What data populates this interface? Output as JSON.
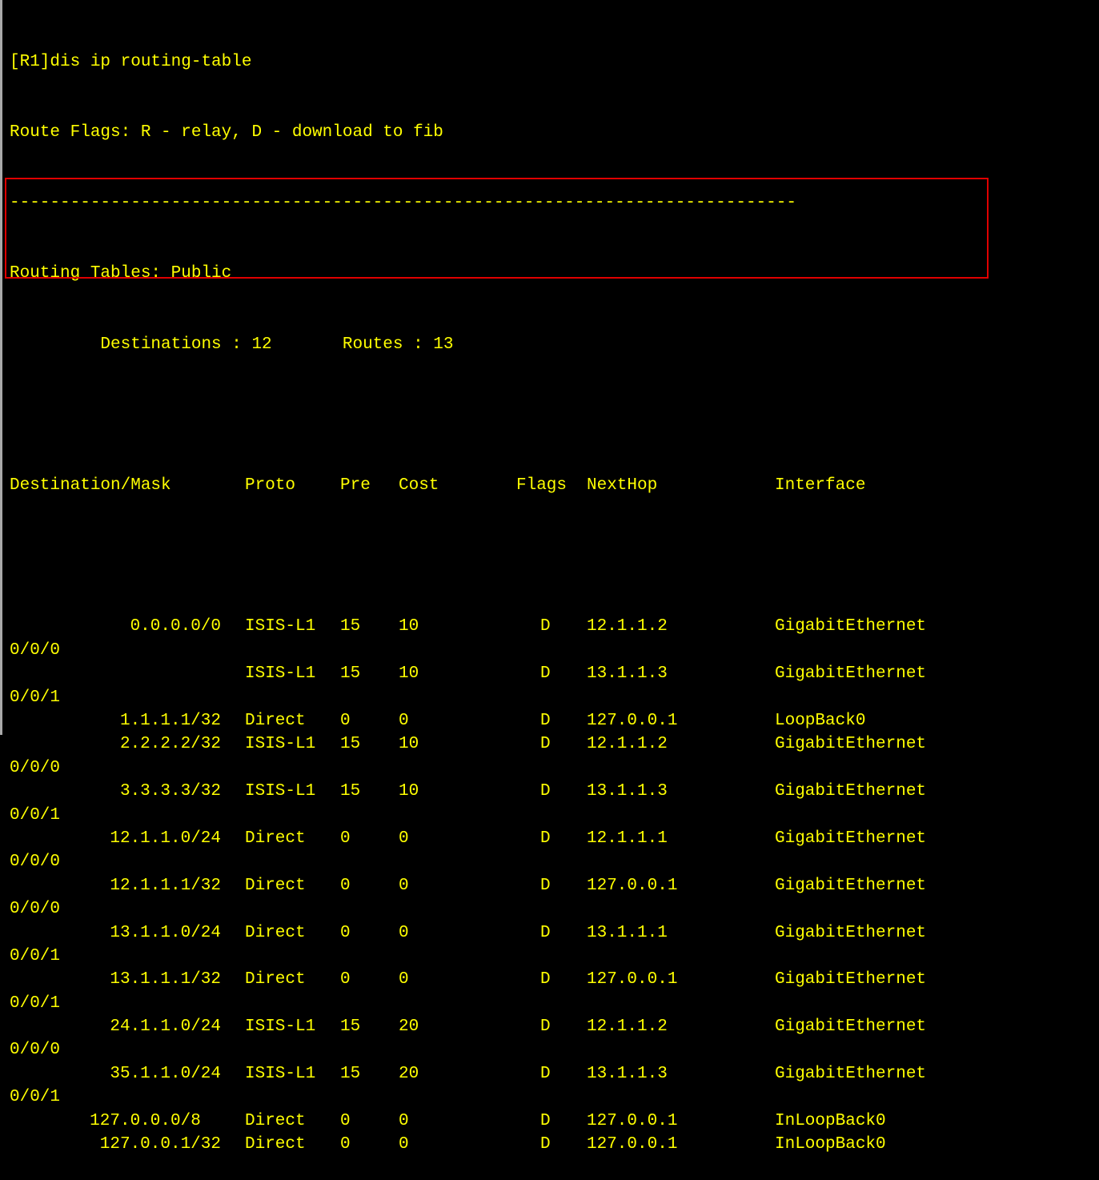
{
  "terminal": {
    "command_line": "[R1]dis ip routing-table",
    "flags_legend": "Route Flags: R - relay, D - download to fib",
    "separator": "------------------------------------------------------------------------------",
    "table_title": "Routing Tables: Public",
    "summary": "         Destinations : 12       Routes : 13",
    "headers": {
      "destination": "Destination/Mask",
      "proto": "Proto",
      "pre": "Pre",
      "cost": "Cost",
      "flags": "Flags",
      "nexthop": "NextHop",
      "interface": "Interface"
    },
    "routes": [
      {
        "dest": "0.0.0.0/0",
        "proto": "ISIS-L1",
        "pre": "15",
        "cost": "10",
        "flags": "D",
        "nexthop": "12.1.1.2",
        "iface": "GigabitEthernet",
        "iface_cont": "0/0/0"
      },
      {
        "dest": "",
        "proto": "ISIS-L1",
        "pre": "15",
        "cost": "10",
        "flags": "D",
        "nexthop": "13.1.1.3",
        "iface": "GigabitEthernet",
        "iface_cont": "0/0/1"
      },
      {
        "dest": "1.1.1.1/32",
        "proto": "Direct",
        "pre": "0",
        "cost": "0",
        "flags": "D",
        "nexthop": "127.0.0.1",
        "iface": "LoopBack0",
        "iface_cont": ""
      },
      {
        "dest": "2.2.2.2/32",
        "proto": "ISIS-L1",
        "pre": "15",
        "cost": "10",
        "flags": "D",
        "nexthop": "12.1.1.2",
        "iface": "GigabitEthernet",
        "iface_cont": "0/0/0"
      },
      {
        "dest": "3.3.3.3/32",
        "proto": "ISIS-L1",
        "pre": "15",
        "cost": "10",
        "flags": "D",
        "nexthop": "13.1.1.3",
        "iface": "GigabitEthernet",
        "iface_cont": "0/0/1"
      },
      {
        "dest": "12.1.1.0/24",
        "proto": "Direct",
        "pre": "0",
        "cost": "0",
        "flags": "D",
        "nexthop": "12.1.1.1",
        "iface": "GigabitEthernet",
        "iface_cont": "0/0/0"
      },
      {
        "dest": "12.1.1.1/32",
        "proto": "Direct",
        "pre": "0",
        "cost": "0",
        "flags": "D",
        "nexthop": "127.0.0.1",
        "iface": "GigabitEthernet",
        "iface_cont": "0/0/0"
      },
      {
        "dest": "13.1.1.0/24",
        "proto": "Direct",
        "pre": "0",
        "cost": "0",
        "flags": "D",
        "nexthop": "13.1.1.1",
        "iface": "GigabitEthernet",
        "iface_cont": "0/0/1"
      },
      {
        "dest": "13.1.1.1/32",
        "proto": "Direct",
        "pre": "0",
        "cost": "0",
        "flags": "D",
        "nexthop": "127.0.0.1",
        "iface": "GigabitEthernet",
        "iface_cont": "0/0/1"
      },
      {
        "dest": "24.1.1.0/24",
        "proto": "ISIS-L1",
        "pre": "15",
        "cost": "20",
        "flags": "D",
        "nexthop": "12.1.1.2",
        "iface": "GigabitEthernet",
        "iface_cont": "0/0/0"
      },
      {
        "dest": "35.1.1.0/24",
        "proto": "ISIS-L1",
        "pre": "15",
        "cost": "20",
        "flags": "D",
        "nexthop": "13.1.1.3",
        "iface": "GigabitEthernet",
        "iface_cont": "0/0/1"
      },
      {
        "dest": "127.0.0.0/8  ",
        "proto": "Direct",
        "pre": "0",
        "cost": "0",
        "flags": "D",
        "nexthop": "127.0.0.1",
        "iface": "InLoopBack0",
        "iface_cont": ""
      },
      {
        "dest": "127.0.0.1/32",
        "proto": "Direct",
        "pre": "0",
        "cost": "0",
        "flags": "D",
        "nexthop": "127.0.0.1",
        "iface": "InLoopBack0",
        "iface_cont": ""
      }
    ],
    "colors": {
      "text": "#ffff00",
      "background": "#000000",
      "highlight": "#e00000"
    }
  }
}
